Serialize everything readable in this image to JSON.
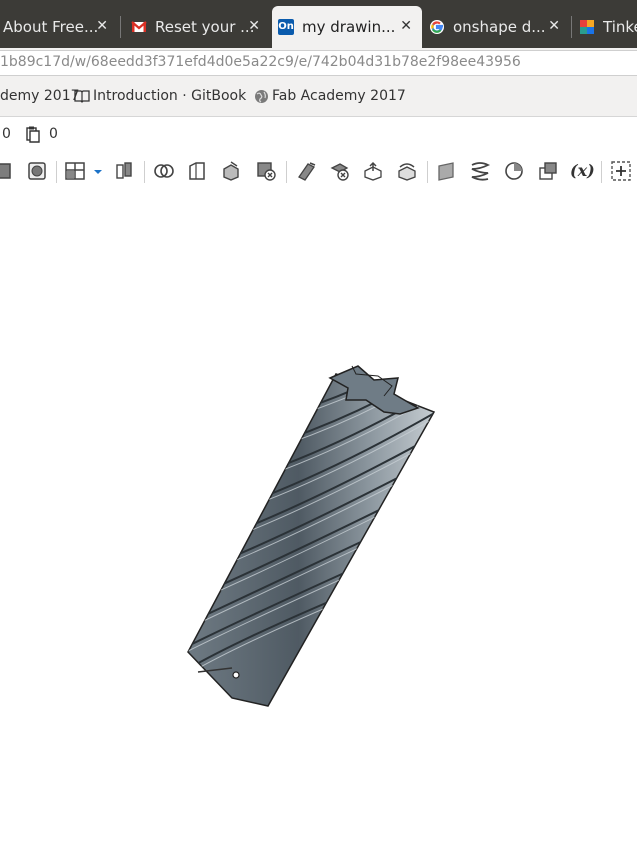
{
  "tabs": [
    {
      "title": "About Free...",
      "icon": "document-icon",
      "active": false
    },
    {
      "title": "Reset your ...",
      "icon": "gmail-icon",
      "active": false
    },
    {
      "title": "my drawin...",
      "icon": "onshape-icon",
      "active": true
    },
    {
      "title": "onshape d...",
      "icon": "google-icon",
      "active": false
    },
    {
      "title": "Tinke",
      "icon": "tinkercad-icon",
      "active": false
    }
  ],
  "close_glyph": "✕",
  "onshape_favicon_text": "On",
  "url": "1b89c17d/w/68eedd3f371efd4d0e5a22c9/e/742b04d31b78e2f98ee43956",
  "bookmarks": [
    {
      "label": "demy 2017",
      "icon": "none"
    },
    {
      "label": "Introduction · GitBook",
      "icon": "book-icon"
    },
    {
      "label": "Fab Academy 2017",
      "icon": "globe-icon"
    }
  ],
  "counts": {
    "first": "0",
    "second": "0"
  },
  "toolbar": {
    "variable_label": "(x)",
    "icons": [
      "box-icon",
      "shell-icon",
      "view-layout-icon",
      "dropdown-arrow-icon",
      "mirror-icon",
      "boolean-icon",
      "chamfer-icon",
      "draft-icon",
      "split-icon",
      "delete-part-icon",
      "transform-icon",
      "delete-face-icon",
      "move-face-icon",
      "replace-face-icon",
      "plane-icon",
      "helix-icon",
      "revolve-icon",
      "pattern-icon",
      "variable-icon",
      "add-feature-icon"
    ]
  },
  "colors": {
    "tabbar": "#3c3b37",
    "model": "#5d6770",
    "model_light": "#9aa4ac"
  }
}
